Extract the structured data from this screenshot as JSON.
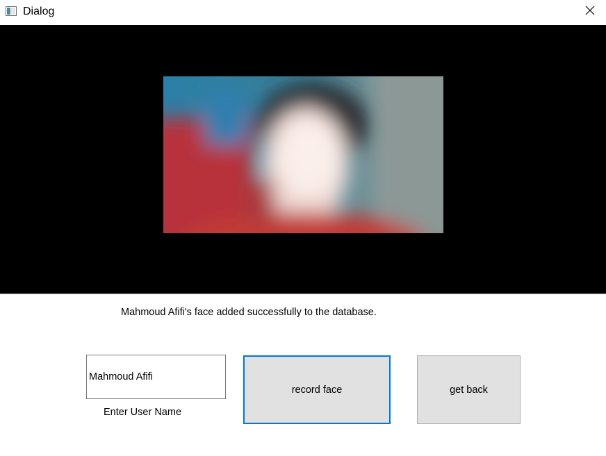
{
  "window": {
    "title": "Dialog"
  },
  "status": {
    "message": "Mahmoud Afifi's face added successfully to the database."
  },
  "form": {
    "name_value": "Mahmoud Afifi",
    "name_label": "Enter User Name",
    "record_button_label": "record face",
    "back_button_label": "get back"
  },
  "icons": {
    "app": "dialog-window-icon",
    "close": "close-icon"
  },
  "colors": {
    "video_background": "#000000",
    "focus_border": "#0078d7",
    "button_face": "#e1e1e1"
  }
}
